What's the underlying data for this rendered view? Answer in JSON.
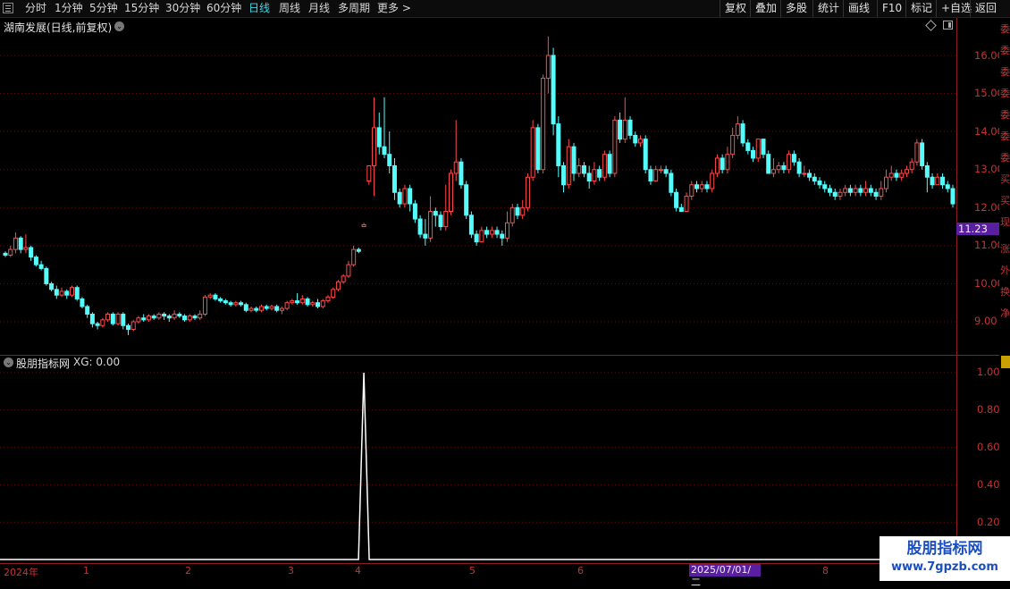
{
  "toolbar": {
    "periods": [
      "分时",
      "1分钟",
      "5分钟",
      "15分钟",
      "30分钟",
      "60分钟",
      "日线",
      "周线",
      "月线",
      "多周期",
      "更多 >"
    ],
    "active_period": "日线",
    "actions": [
      "复权",
      "叠加",
      "多股",
      "统计",
      "画线",
      "F10",
      "标记",
      "+自选",
      "返回"
    ]
  },
  "main_panel": {
    "title": "湖南发展(日线,前复权)",
    "price_axis": [
      "16.00",
      "15.00",
      "14.00",
      "13.00",
      "12.00",
      "11.00",
      "10.00",
      "9.00"
    ],
    "current_price_tag": "11.23"
  },
  "indicator_panel": {
    "title": "股朋指标网",
    "formula": "XG: 0.00",
    "axis": [
      "1.00",
      "0.80",
      "0.60",
      "0.40",
      "0.20"
    ]
  },
  "x_axis": {
    "labels": [
      "2024年",
      "1",
      "2",
      "3",
      "4",
      "5",
      "6",
      "8"
    ],
    "cursor_date": "2025/07/01/二"
  },
  "side_strip_chars": [
    "委",
    "委",
    "委",
    "委",
    "委",
    "委",
    "委",
    "买",
    "买",
    "现",
    "涨",
    "外",
    "换",
    "净"
  ],
  "watermark": {
    "title": "股朋指标网",
    "url": "www.7gpzb.com"
  },
  "colors": {
    "up": "#ff4a4a",
    "down": "#54fcfc",
    "grid": "#5a1010",
    "axis": "#8b1e1e",
    "signal": "#ffffff"
  },
  "chart_data": [
    {
      "type": "candlestick",
      "title": "湖南发展(日线,前复权)",
      "ylim": [
        8.2,
        16.6
      ],
      "grid": true,
      "candles": [
        [
          10.8,
          10.75,
          10.85,
          10.7
        ],
        [
          10.75,
          10.9,
          11.0,
          10.7
        ],
        [
          10.9,
          11.2,
          11.35,
          10.8
        ],
        [
          11.2,
          10.9,
          11.25,
          10.8
        ],
        [
          10.9,
          10.95,
          11.3,
          10.8
        ],
        [
          10.95,
          10.7,
          11.0,
          10.6
        ],
        [
          10.7,
          10.5,
          10.75,
          10.45
        ],
        [
          10.5,
          10.4,
          10.6,
          10.35
        ],
        [
          10.4,
          10.0,
          10.45,
          9.95
        ],
        [
          10.0,
          9.85,
          10.05,
          9.8
        ],
        [
          9.85,
          9.7,
          9.95,
          9.6
        ],
        [
          9.7,
          9.8,
          9.9,
          9.65
        ],
        [
          9.8,
          9.7,
          9.85,
          9.6
        ],
        [
          9.7,
          9.9,
          9.95,
          9.65
        ],
        [
          9.9,
          9.6,
          9.95,
          9.55
        ],
        [
          9.6,
          9.4,
          9.65,
          9.35
        ],
        [
          9.4,
          9.2,
          9.45,
          9.1
        ],
        [
          9.2,
          8.95,
          9.25,
          8.85
        ],
        [
          8.95,
          8.9,
          9.0,
          8.8
        ],
        [
          8.9,
          9.05,
          9.1,
          8.85
        ],
        [
          9.05,
          9.2,
          9.25,
          9.0
        ],
        [
          9.2,
          8.95,
          9.25,
          8.9
        ],
        [
          8.95,
          9.2,
          9.25,
          8.9
        ],
        [
          9.2,
          8.9,
          9.25,
          8.8
        ],
        [
          8.9,
          8.8,
          8.95,
          8.65
        ],
        [
          8.8,
          9.0,
          9.05,
          8.75
        ],
        [
          9.0,
          9.1,
          9.15,
          8.95
        ],
        [
          9.1,
          9.05,
          9.2,
          9.0
        ],
        [
          9.05,
          9.15,
          9.2,
          9.0
        ],
        [
          9.15,
          9.1,
          9.2,
          9.05
        ],
        [
          9.1,
          9.2,
          9.25,
          9.05
        ],
        [
          9.2,
          9.15,
          9.25,
          9.05
        ],
        [
          9.15,
          9.1,
          9.2,
          9.0
        ],
        [
          9.1,
          9.2,
          9.3,
          9.05
        ],
        [
          9.2,
          9.15,
          9.25,
          9.1
        ],
        [
          9.15,
          9.05,
          9.2,
          9.0
        ],
        [
          9.05,
          9.15,
          9.2,
          9.0
        ],
        [
          9.15,
          9.1,
          9.2,
          9.05
        ],
        [
          9.1,
          9.2,
          9.3,
          9.05
        ],
        [
          9.2,
          9.65,
          9.7,
          9.15
        ],
        [
          9.65,
          9.7,
          9.75,
          9.6
        ],
        [
          9.7,
          9.6,
          9.75,
          9.55
        ],
        [
          9.6,
          9.55,
          9.65,
          9.5
        ],
        [
          9.55,
          9.5,
          9.6,
          9.45
        ],
        [
          9.5,
          9.45,
          9.55,
          9.4
        ],
        [
          9.45,
          9.5,
          9.55,
          9.4
        ],
        [
          9.5,
          9.45,
          9.55,
          9.4
        ],
        [
          9.45,
          9.3,
          9.5,
          9.25
        ],
        [
          9.3,
          9.35,
          9.4,
          9.25
        ],
        [
          9.35,
          9.3,
          9.4,
          9.25
        ],
        [
          9.3,
          9.4,
          9.45,
          9.25
        ],
        [
          9.4,
          9.35,
          9.45,
          9.3
        ],
        [
          9.35,
          9.4,
          9.45,
          9.3
        ],
        [
          9.4,
          9.3,
          9.45,
          9.25
        ],
        [
          9.3,
          9.35,
          9.4,
          9.2
        ],
        [
          9.35,
          9.5,
          9.55,
          9.3
        ],
        [
          9.5,
          9.55,
          9.6,
          9.45
        ],
        [
          9.55,
          9.5,
          9.75,
          9.45
        ],
        [
          9.5,
          9.6,
          9.7,
          9.45
        ],
        [
          9.6,
          9.45,
          9.65,
          9.4
        ],
        [
          9.45,
          9.5,
          9.55,
          9.4
        ],
        [
          9.5,
          9.4,
          9.6,
          9.35
        ],
        [
          9.4,
          9.55,
          9.6,
          9.35
        ],
        [
          9.55,
          9.65,
          9.7,
          9.5
        ],
        [
          9.65,
          9.85,
          9.9,
          9.6
        ],
        [
          9.85,
          10.05,
          10.1,
          9.8
        ],
        [
          10.05,
          10.2,
          10.25,
          10.0
        ],
        [
          10.2,
          10.5,
          10.6,
          10.15
        ],
        [
          10.5,
          10.9,
          11.0,
          10.45
        ],
        [
          10.9,
          10.85,
          10.95,
          10.8
        ],
        [
          11.5,
          11.55,
          11.6,
          11.5
        ],
        [
          12.7,
          13.1,
          13.1,
          12.6
        ],
        [
          13.1,
          14.1,
          14.9,
          12.3
        ],
        [
          14.1,
          13.6,
          14.5,
          13.4
        ],
        [
          13.6,
          13.4,
          14.9,
          13.3
        ],
        [
          13.4,
          13.1,
          14.0,
          12.9
        ],
        [
          13.1,
          12.4,
          13.3,
          12.2
        ],
        [
          12.4,
          12.1,
          12.5,
          12.0
        ],
        [
          12.1,
          12.5,
          12.6,
          12.0
        ],
        [
          12.5,
          12.1,
          12.6,
          11.9
        ],
        [
          12.1,
          11.7,
          12.2,
          11.6
        ],
        [
          11.7,
          11.3,
          11.8,
          11.2
        ],
        [
          11.3,
          11.2,
          11.7,
          11.0
        ],
        [
          11.2,
          11.9,
          12.3,
          11.1
        ],
        [
          11.9,
          11.8,
          12.0,
          11.5
        ],
        [
          11.8,
          11.5,
          11.9,
          11.4
        ],
        [
          11.5,
          11.9,
          12.6,
          11.4
        ],
        [
          11.9,
          12.9,
          13.0,
          11.8
        ],
        [
          12.9,
          13.2,
          14.3,
          12.7
        ],
        [
          13.2,
          12.6,
          13.3,
          12.5
        ],
        [
          12.6,
          11.8,
          12.7,
          11.7
        ],
        [
          11.8,
          11.3,
          11.9,
          11.2
        ],
        [
          11.3,
          11.1,
          11.4,
          11.0
        ],
        [
          11.1,
          11.4,
          11.5,
          11.1
        ],
        [
          11.4,
          11.3,
          11.5,
          11.2
        ],
        [
          11.3,
          11.4,
          11.5,
          11.2
        ],
        [
          11.4,
          11.3,
          11.5,
          11.2
        ],
        [
          11.3,
          11.2,
          11.4,
          11.0
        ],
        [
          11.2,
          11.6,
          11.9,
          11.1
        ],
        [
          11.6,
          12.0,
          12.1,
          11.5
        ],
        [
          12.0,
          11.8,
          12.1,
          11.7
        ],
        [
          11.8,
          12.0,
          12.2,
          11.7
        ],
        [
          12.0,
          12.8,
          12.9,
          11.9
        ],
        [
          12.8,
          14.1,
          14.3,
          12.7
        ],
        [
          14.1,
          13.0,
          14.2,
          12.9
        ],
        [
          13.0,
          15.4,
          15.5,
          12.9
        ],
        [
          15.4,
          16.0,
          16.5,
          15.0
        ],
        [
          16.0,
          14.2,
          16.2,
          13.9
        ],
        [
          14.2,
          13.1,
          14.4,
          12.8
        ],
        [
          13.1,
          12.6,
          13.2,
          12.4
        ],
        [
          12.6,
          13.6,
          13.8,
          12.5
        ],
        [
          13.6,
          12.9,
          13.7,
          12.7
        ],
        [
          12.9,
          13.1,
          13.3,
          12.8
        ],
        [
          13.1,
          12.9,
          13.2,
          12.8
        ],
        [
          12.9,
          12.7,
          13.1,
          12.5
        ],
        [
          12.7,
          13.0,
          13.2,
          12.6
        ],
        [
          13.0,
          12.8,
          13.1,
          12.7
        ],
        [
          12.8,
          13.4,
          13.5,
          12.7
        ],
        [
          13.4,
          12.9,
          13.5,
          12.8
        ],
        [
          12.9,
          14.3,
          14.4,
          12.8
        ],
        [
          14.3,
          13.8,
          14.5,
          13.7
        ],
        [
          13.8,
          14.3,
          14.9,
          13.7
        ],
        [
          14.3,
          13.9,
          14.4,
          13.8
        ],
        [
          13.9,
          13.7,
          14.0,
          13.6
        ],
        [
          13.7,
          13.8,
          13.9,
          13.6
        ],
        [
          13.8,
          13.0,
          13.9,
          12.9
        ],
        [
          13.0,
          12.7,
          13.1,
          12.6
        ],
        [
          12.7,
          13.0,
          13.1,
          12.7
        ],
        [
          13.0,
          13.0,
          13.1,
          12.9
        ],
        [
          13.0,
          12.9,
          13.1,
          12.8
        ],
        [
          12.9,
          12.4,
          13.0,
          12.3
        ],
        [
          12.4,
          12.0,
          12.5,
          11.9
        ],
        [
          12.0,
          11.9,
          12.1,
          11.9
        ],
        [
          11.9,
          12.3,
          12.4,
          11.9
        ],
        [
          12.3,
          12.6,
          12.7,
          12.2
        ],
        [
          12.6,
          12.5,
          12.7,
          12.4
        ],
        [
          12.5,
          12.6,
          12.7,
          12.4
        ],
        [
          12.6,
          12.5,
          12.7,
          12.4
        ],
        [
          12.5,
          12.9,
          13.0,
          12.4
        ],
        [
          12.9,
          13.3,
          13.4,
          12.8
        ],
        [
          13.3,
          13.0,
          13.4,
          12.9
        ],
        [
          13.0,
          13.4,
          13.6,
          12.9
        ],
        [
          13.4,
          13.9,
          14.1,
          13.3
        ],
        [
          13.9,
          14.2,
          14.4,
          13.8
        ],
        [
          14.2,
          13.7,
          14.3,
          13.6
        ],
        [
          13.7,
          13.5,
          13.8,
          13.4
        ],
        [
          13.5,
          13.3,
          13.6,
          13.2
        ],
        [
          13.3,
          13.8,
          13.8,
          13.2
        ],
        [
          13.8,
          13.4,
          13.8,
          13.3
        ],
        [
          13.4,
          12.9,
          13.5,
          12.9
        ],
        [
          12.9,
          13.0,
          13.3,
          12.8
        ],
        [
          13.0,
          13.1,
          13.2,
          12.9
        ],
        [
          13.1,
          13.0,
          13.2,
          12.9
        ],
        [
          13.0,
          13.4,
          13.5,
          12.9
        ],
        [
          13.4,
          13.2,
          13.5,
          13.1
        ],
        [
          13.2,
          12.9,
          13.3,
          12.8
        ],
        [
          12.9,
          12.9,
          13.1,
          12.8
        ],
        [
          12.9,
          12.8,
          13.0,
          12.7
        ],
        [
          12.8,
          12.7,
          12.9,
          12.6
        ],
        [
          12.7,
          12.6,
          12.8,
          12.5
        ],
        [
          12.6,
          12.5,
          12.7,
          12.4
        ],
        [
          12.5,
          12.4,
          12.6,
          12.3
        ],
        [
          12.4,
          12.3,
          12.5,
          12.2
        ],
        [
          12.3,
          12.4,
          12.5,
          12.2
        ],
        [
          12.4,
          12.5,
          12.6,
          12.3
        ],
        [
          12.5,
          12.4,
          12.6,
          12.3
        ],
        [
          12.4,
          12.5,
          12.6,
          12.3
        ],
        [
          12.5,
          12.4,
          12.6,
          12.3
        ],
        [
          12.4,
          12.5,
          12.7,
          12.3
        ],
        [
          12.5,
          12.4,
          12.6,
          12.3
        ],
        [
          12.4,
          12.3,
          12.5,
          12.2
        ],
        [
          12.3,
          12.5,
          12.7,
          12.2
        ],
        [
          12.5,
          12.8,
          13.0,
          12.4
        ],
        [
          12.8,
          12.9,
          13.1,
          12.7
        ],
        [
          12.9,
          12.8,
          13.0,
          12.7
        ],
        [
          12.8,
          12.9,
          13.0,
          12.7
        ],
        [
          12.9,
          13.0,
          13.1,
          12.8
        ],
        [
          13.0,
          13.2,
          13.3,
          12.9
        ],
        [
          13.2,
          13.7,
          13.8,
          13.1
        ],
        [
          13.7,
          13.1,
          13.8,
          13.0
        ],
        [
          13.1,
          12.8,
          13.2,
          12.4
        ],
        [
          12.8,
          12.6,
          12.9,
          12.5
        ],
        [
          12.6,
          12.8,
          12.9,
          12.6
        ],
        [
          12.8,
          12.6,
          12.9,
          12.5
        ],
        [
          12.6,
          12.5,
          12.7,
          12.4
        ],
        [
          12.5,
          12.1,
          12.6,
          12.0
        ]
      ]
    },
    {
      "type": "line",
      "title": "股朋指标网",
      "series": [
        {
          "name": "XG",
          "spike_index": 70,
          "spike_value": 1.0,
          "baseline": 0.0
        }
      ],
      "ylim": [
        0,
        1.05
      ]
    }
  ]
}
